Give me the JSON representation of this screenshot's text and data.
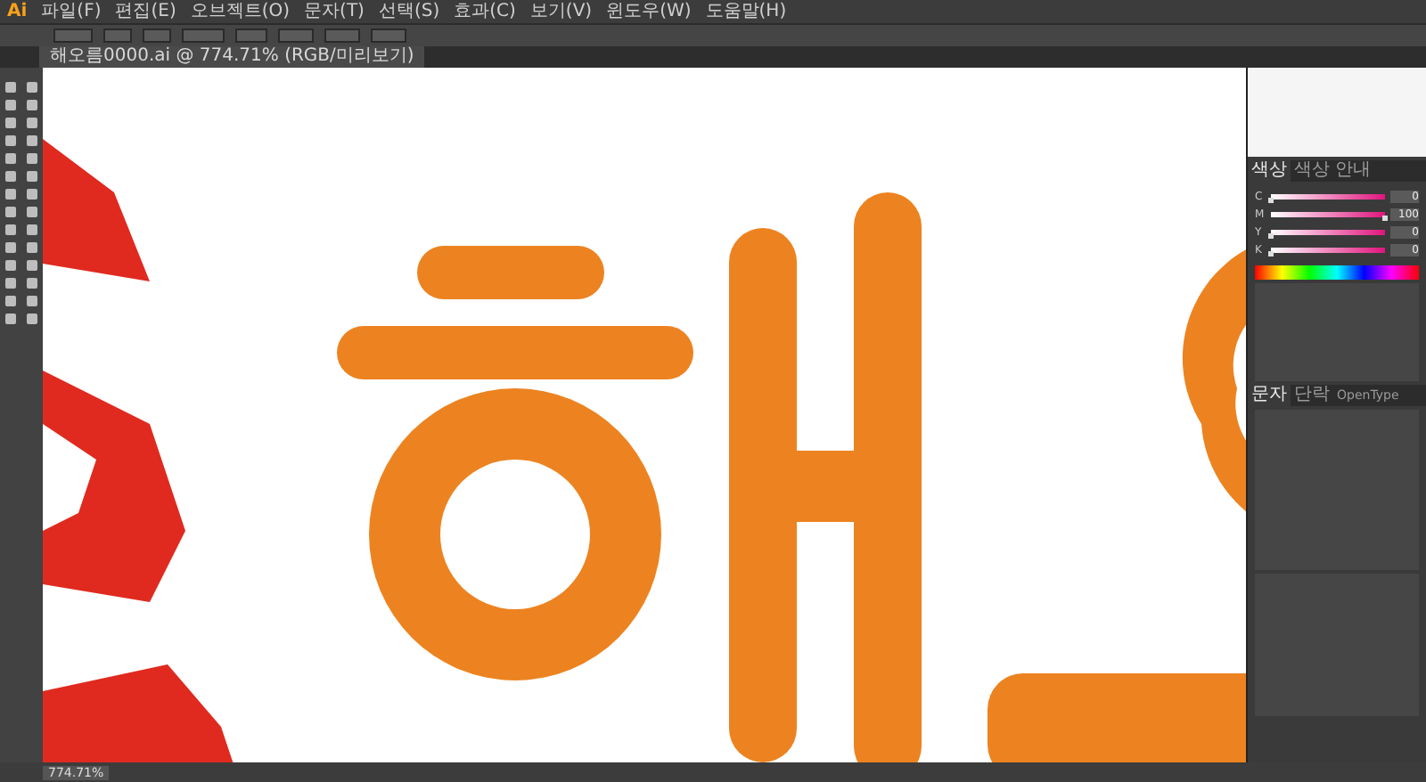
{
  "app": {
    "logo": "Ai"
  },
  "menus": [
    {
      "label": "파일(F)"
    },
    {
      "label": "편집(E)"
    },
    {
      "label": "오브젝트(O)"
    },
    {
      "label": "문자(T)"
    },
    {
      "label": "선택(S)"
    },
    {
      "label": "효과(C)"
    },
    {
      "label": "보기(V)"
    },
    {
      "label": "윈도우(W)"
    },
    {
      "label": "도움말(H)"
    }
  ],
  "document_tab": {
    "title": "해오름0000.ai @ 774.71% (RGB/미리보기)"
  },
  "color_panel": {
    "tabs": [
      {
        "label": "색상",
        "selected": true
      },
      {
        "label": "색상 안내",
        "selected": false
      }
    ],
    "sliders": [
      {
        "label": "C",
        "level": 0.0,
        "reading": "0"
      },
      {
        "label": "M",
        "level": 1.0,
        "reading": "100"
      },
      {
        "label": "Y",
        "level": 0.0,
        "reading": "0"
      },
      {
        "label": "K",
        "level": 0.0,
        "reading": "0"
      }
    ]
  },
  "character_panel": {
    "tabs": [
      {
        "label": "문자",
        "selected": true
      },
      {
        "label": "단락",
        "selected": false
      },
      {
        "label": "OpenType",
        "selected": false
      }
    ]
  },
  "status_bar": {
    "zoom": "774.71%"
  }
}
